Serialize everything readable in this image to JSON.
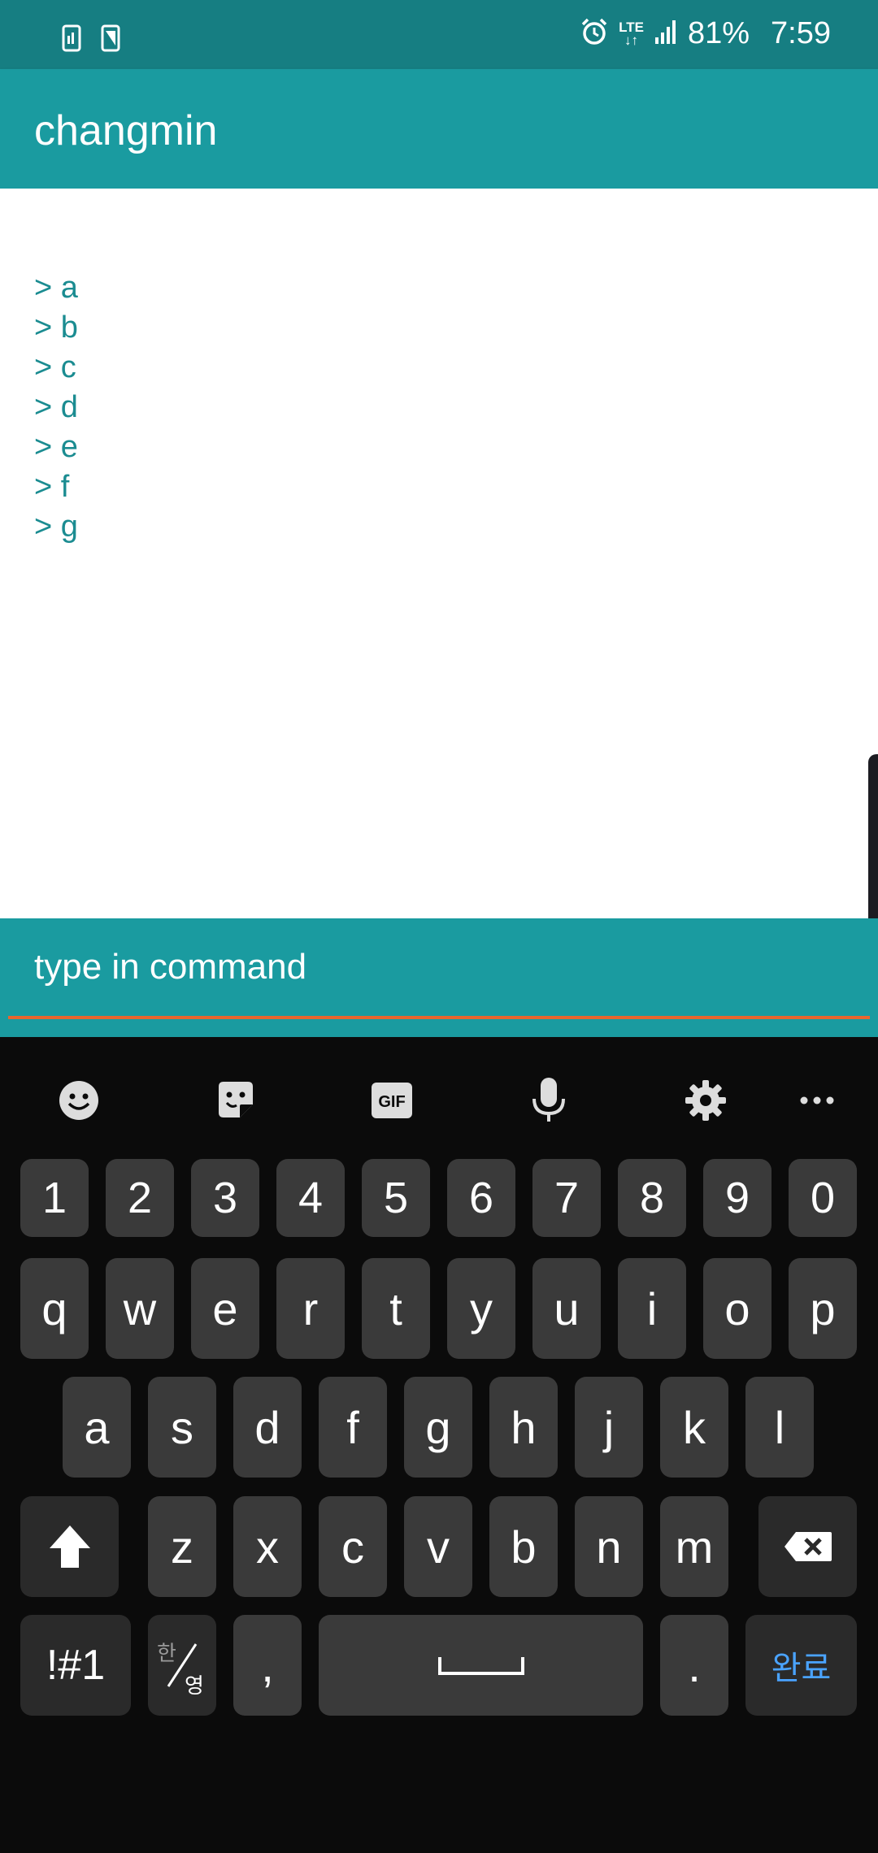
{
  "status_bar": {
    "battery": "81%",
    "time": "7:59",
    "network": "LTE",
    "icons": [
      "sim-icon",
      "screen-icon",
      "alarm-icon",
      "lte-icon",
      "signal-icon"
    ]
  },
  "app_bar": {
    "title": "changmin"
  },
  "log": {
    "lines": [
      "> a",
      "> b",
      "> c",
      "> d",
      "> e",
      "> f",
      "> g"
    ]
  },
  "command": {
    "placeholder": "type in command",
    "value": ""
  },
  "keyboard": {
    "toolbar": [
      "emoji-icon",
      "sticker-icon",
      "gif-icon",
      "mic-icon",
      "settings-icon",
      "more-icon"
    ],
    "gif_label": "GIF",
    "numbers": [
      "1",
      "2",
      "3",
      "4",
      "5",
      "6",
      "7",
      "8",
      "9",
      "0"
    ],
    "row1": [
      "q",
      "w",
      "e",
      "r",
      "t",
      "y",
      "u",
      "i",
      "o",
      "p"
    ],
    "row2": [
      "a",
      "s",
      "d",
      "f",
      "g",
      "h",
      "j",
      "k",
      "l"
    ],
    "row3": [
      "z",
      "x",
      "c",
      "v",
      "b",
      "n",
      "m"
    ],
    "symbols_label": "!#1",
    "lang_top": "한",
    "lang_bottom": "영",
    "comma": ",",
    "period": ".",
    "done_label": "완료"
  },
  "colors": {
    "status_bar": "#167e82",
    "app_bar": "#1a9ba0",
    "log_text": "#1b8c91",
    "input_underline": "#e8662e",
    "done_accent": "#4aa3ff"
  }
}
